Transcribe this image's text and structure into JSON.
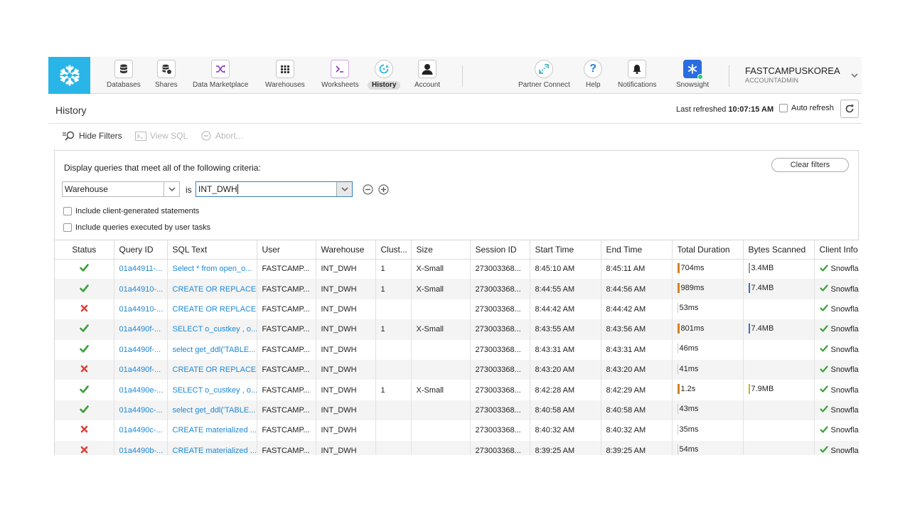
{
  "nav": {
    "items": [
      {
        "label": "Databases",
        "icon": "database-icon"
      },
      {
        "label": "Shares",
        "icon": "shares-icon"
      },
      {
        "label": "Data Marketplace",
        "icon": "marketplace-icon"
      },
      {
        "label": "Warehouses",
        "icon": "warehouse-icon"
      },
      {
        "label": "Worksheets",
        "icon": "worksheet-icon"
      },
      {
        "label": "History",
        "icon": "history-icon",
        "active": true
      },
      {
        "label": "Account",
        "icon": "account-icon"
      },
      {
        "label": "Partner Connect",
        "icon": "partner-connect-icon"
      },
      {
        "label": "Help",
        "icon": "help-icon"
      },
      {
        "label": "Notifications",
        "icon": "bell-icon"
      },
      {
        "label": "Snowsight",
        "icon": "snowsight-icon"
      }
    ],
    "account_name": "FASTCAMPUSKOREA",
    "account_role": "ACCOUNTADMIN"
  },
  "header": {
    "title": "History",
    "last_refreshed_label": "Last refreshed",
    "last_refreshed_time": "10:07:15 AM",
    "auto_refresh_label": "Auto refresh"
  },
  "toolbar": {
    "hide_filters": "Hide Filters",
    "view_sql": "View SQL",
    "abort": "Abort..."
  },
  "filters": {
    "caption": "Display queries that meet all of the following criteria:",
    "clear_label": "Clear filters",
    "field_value": "Warehouse",
    "operator": "is",
    "value": "INT_DWH",
    "include_client": "Include client-generated statements",
    "include_tasks": "Include queries executed by user tasks"
  },
  "colors": {
    "accent": "#29b5e8",
    "link": "#1e88d6",
    "success": "#3aa03a",
    "fail": "#e0403a",
    "duration_bar": "#d4821e",
    "bytes_bar": "#3b6fc4"
  },
  "table": {
    "columns": [
      "Status",
      "Query ID",
      "SQL Text",
      "User",
      "Warehouse",
      "Clust...",
      "Size",
      "Session ID",
      "Start Time",
      "End Time",
      "Total Duration",
      "Bytes Scanned",
      "Client Info"
    ],
    "rows": [
      {
        "status": "success",
        "query_id": "01a44911-...",
        "sql": "Select * from open_o...",
        "user": "FASTCAMP...",
        "warehouse": "INT_DWH",
        "cluster": "1",
        "size": "X-Small",
        "session": "273003368...",
        "start": "8:45:10 AM",
        "end": "8:45:11 AM",
        "duration": "704ms",
        "duration_bar": "orange",
        "bytes": "3.4MB",
        "bytes_bar": "gray",
        "client": "Snowflake"
      },
      {
        "status": "success",
        "query_id": "01a44910-...",
        "sql": "CREATE OR REPLACE...",
        "user": "FASTCAMP...",
        "warehouse": "INT_DWH",
        "cluster": "1",
        "size": "X-Small",
        "session": "273003368...",
        "start": "8:44:55 AM",
        "end": "8:44:56 AM",
        "duration": "989ms",
        "duration_bar": "orange",
        "bytes": "7.4MB",
        "bytes_bar": "blue",
        "client": "Snowflake"
      },
      {
        "status": "fail",
        "query_id": "01a44910-...",
        "sql": "CREATE OR REPLACE...",
        "user": "FASTCAMP...",
        "warehouse": "INT_DWH",
        "cluster": "",
        "size": "",
        "session": "273003368...",
        "start": "8:44:42 AM",
        "end": "8:44:42 AM",
        "duration": "53ms",
        "duration_bar": "thin",
        "bytes": "",
        "bytes_bar": "none",
        "client": "Snowflake"
      },
      {
        "status": "success",
        "query_id": "01a4490f-...",
        "sql": "SELECT o_custkey , o...",
        "user": "FASTCAMP...",
        "warehouse": "INT_DWH",
        "cluster": "1",
        "size": "X-Small",
        "session": "273003368...",
        "start": "8:43:55 AM",
        "end": "8:43:56 AM",
        "duration": "801ms",
        "duration_bar": "orange",
        "bytes": "7.4MB",
        "bytes_bar": "blue",
        "client": "Snowflake"
      },
      {
        "status": "success",
        "query_id": "01a4490f-...",
        "sql": "select get_ddl('TABLE...",
        "user": "FASTCAMP...",
        "warehouse": "INT_DWH",
        "cluster": "",
        "size": "",
        "session": "273003368...",
        "start": "8:43:31 AM",
        "end": "8:43:31 AM",
        "duration": "46ms",
        "duration_bar": "thin",
        "bytes": "",
        "bytes_bar": "none",
        "client": "Snowflake"
      },
      {
        "status": "fail",
        "query_id": "01a4490f-...",
        "sql": "CREATE OR REPLACE...",
        "user": "FASTCAMP...",
        "warehouse": "INT_DWH",
        "cluster": "",
        "size": "",
        "session": "273003368...",
        "start": "8:43:20 AM",
        "end": "8:43:20 AM",
        "duration": "41ms",
        "duration_bar": "thin",
        "bytes": "",
        "bytes_bar": "none",
        "client": "Snowflake"
      },
      {
        "status": "success",
        "query_id": "01a4490e-...",
        "sql": "SELECT o_custkey , o...",
        "user": "FASTCAMP...",
        "warehouse": "INT_DWH",
        "cluster": "1",
        "size": "X-Small",
        "session": "273003368...",
        "start": "8:42:28 AM",
        "end": "8:42:29 AM",
        "duration": "1.2s",
        "duration_bar": "orange",
        "bytes": "7.9MB",
        "bytes_bar": "yellow",
        "client": "Snowflake"
      },
      {
        "status": "success",
        "query_id": "01a4490c-...",
        "sql": "select get_ddl('TABLE...",
        "user": "FASTCAMP...",
        "warehouse": "INT_DWH",
        "cluster": "",
        "size": "",
        "session": "273003368...",
        "start": "8:40:58 AM",
        "end": "8:40:58 AM",
        "duration": "43ms",
        "duration_bar": "thin",
        "bytes": "",
        "bytes_bar": "none",
        "client": "Snowflake"
      },
      {
        "status": "fail",
        "query_id": "01a4490c-...",
        "sql": "CREATE materialized ...",
        "user": "FASTCAMP...",
        "warehouse": "INT_DWH",
        "cluster": "",
        "size": "",
        "session": "273003368...",
        "start": "8:40:32 AM",
        "end": "8:40:32 AM",
        "duration": "35ms",
        "duration_bar": "thin",
        "bytes": "",
        "bytes_bar": "none",
        "client": "Snowflake"
      },
      {
        "status": "fail",
        "query_id": "01a4490b-...",
        "sql": "CREATE materialized ...",
        "user": "FASTCAMP...",
        "warehouse": "INT_DWH",
        "cluster": "",
        "size": "",
        "session": "273003368...",
        "start": "8:39:25 AM",
        "end": "8:39:25 AM",
        "duration": "54ms",
        "duration_bar": "thin",
        "bytes": "",
        "bytes_bar": "none",
        "client": "Snowflake"
      }
    ]
  }
}
